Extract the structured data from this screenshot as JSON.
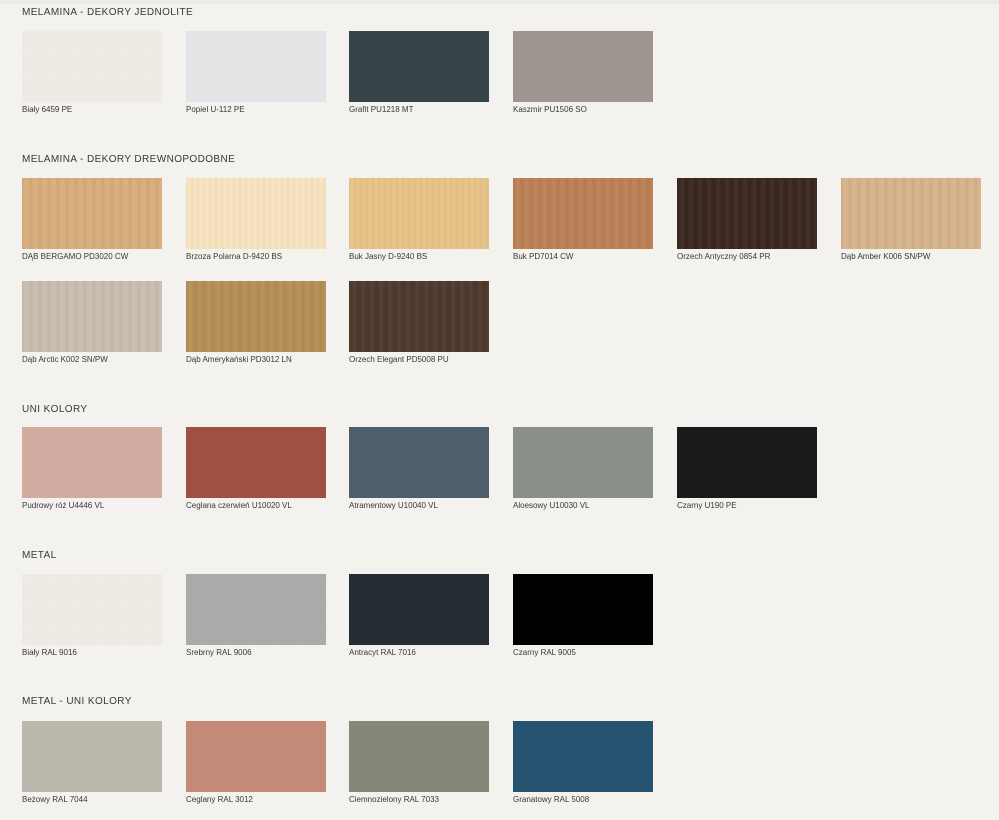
{
  "sections": [
    {
      "title": "MELAMINA - DEKORY JEDNOLITE",
      "items": [
        {
          "label": "Biały 6459 PE",
          "color": "#f0ede6"
        },
        {
          "label": "Popiel U-112 PE",
          "color": "#e2e4e5"
        },
        {
          "label": "Grafit PU1218 MT",
          "color": "#37444a"
        },
        {
          "label": "Kaszmir PU1506 SO",
          "color": "#9e9590"
        }
      ]
    },
    {
      "title": "MELAMINA - DEKORY DREWNOPODOBNE",
      "items": [
        {
          "label": "DĄB BERGAMO PD3020 CW",
          "color": "#d8ad7a"
        },
        {
          "label": "Brzoza Polarna D-9420 BS",
          "color": "#f9e4c0"
        },
        {
          "label": "Buk Jasny D-9240 BS",
          "color": "#e8c487"
        },
        {
          "label": "Buk PD7014 CW",
          "color": "#bb7f55"
        },
        {
          "label": "Orzech Antyczny 0854 PR",
          "color": "#3a271f"
        },
        {
          "label": "Dąb Amber K006 SN/PW",
          "color": "#d6b38b"
        },
        {
          "label": "Dąb Arctic K002 SN/PW",
          "color": "#c9bdb0"
        },
        {
          "label": "Dąb Amerykański PD3012 LN",
          "color": "#b48f55"
        },
        {
          "label": "Orzech Elegant PD5008 PU",
          "color": "#4e392c"
        }
      ]
    },
    {
      "title": "UNI KOLORY",
      "items": [
        {
          "label": "Pudrowy róż U4446 VL",
          "color": "#d2aca0"
        },
        {
          "label": "Ceglana czerwień U10020 VL",
          "color": "#9f5040"
        },
        {
          "label": "Atramentowy U10040 VL",
          "color": "#4f5e6b"
        },
        {
          "label": "Aloesowy U10030 VL",
          "color": "#8a8f88"
        },
        {
          "label": "Czarny U190 PE",
          "color": "#1a1a1c"
        }
      ]
    },
    {
      "title": "METAL",
      "items": [
        {
          "label": "Biały RAL 9016",
          "color": "#f0ede6"
        },
        {
          "label": "Srebrny RAL 9006",
          "color": "#aaadab"
        },
        {
          "label": "Antracyt RAL 7016",
          "color": "#262c34"
        },
        {
          "label": "Czarny RAL 9005",
          "color": "#000000"
        }
      ]
    },
    {
      "title": "METAL - UNI KOLORY",
      "items": [
        {
          "label": "Beżowy RAL 7044",
          "color": "#bcb8ad"
        },
        {
          "label": "Ceglany RAL 3012",
          "color": "#c38a78"
        },
        {
          "label": "Ciemnozielony RAL 7033",
          "color": "#858878"
        },
        {
          "label": "Granatowy RAL 5008",
          "color": "#25526e"
        }
      ]
    }
  ]
}
